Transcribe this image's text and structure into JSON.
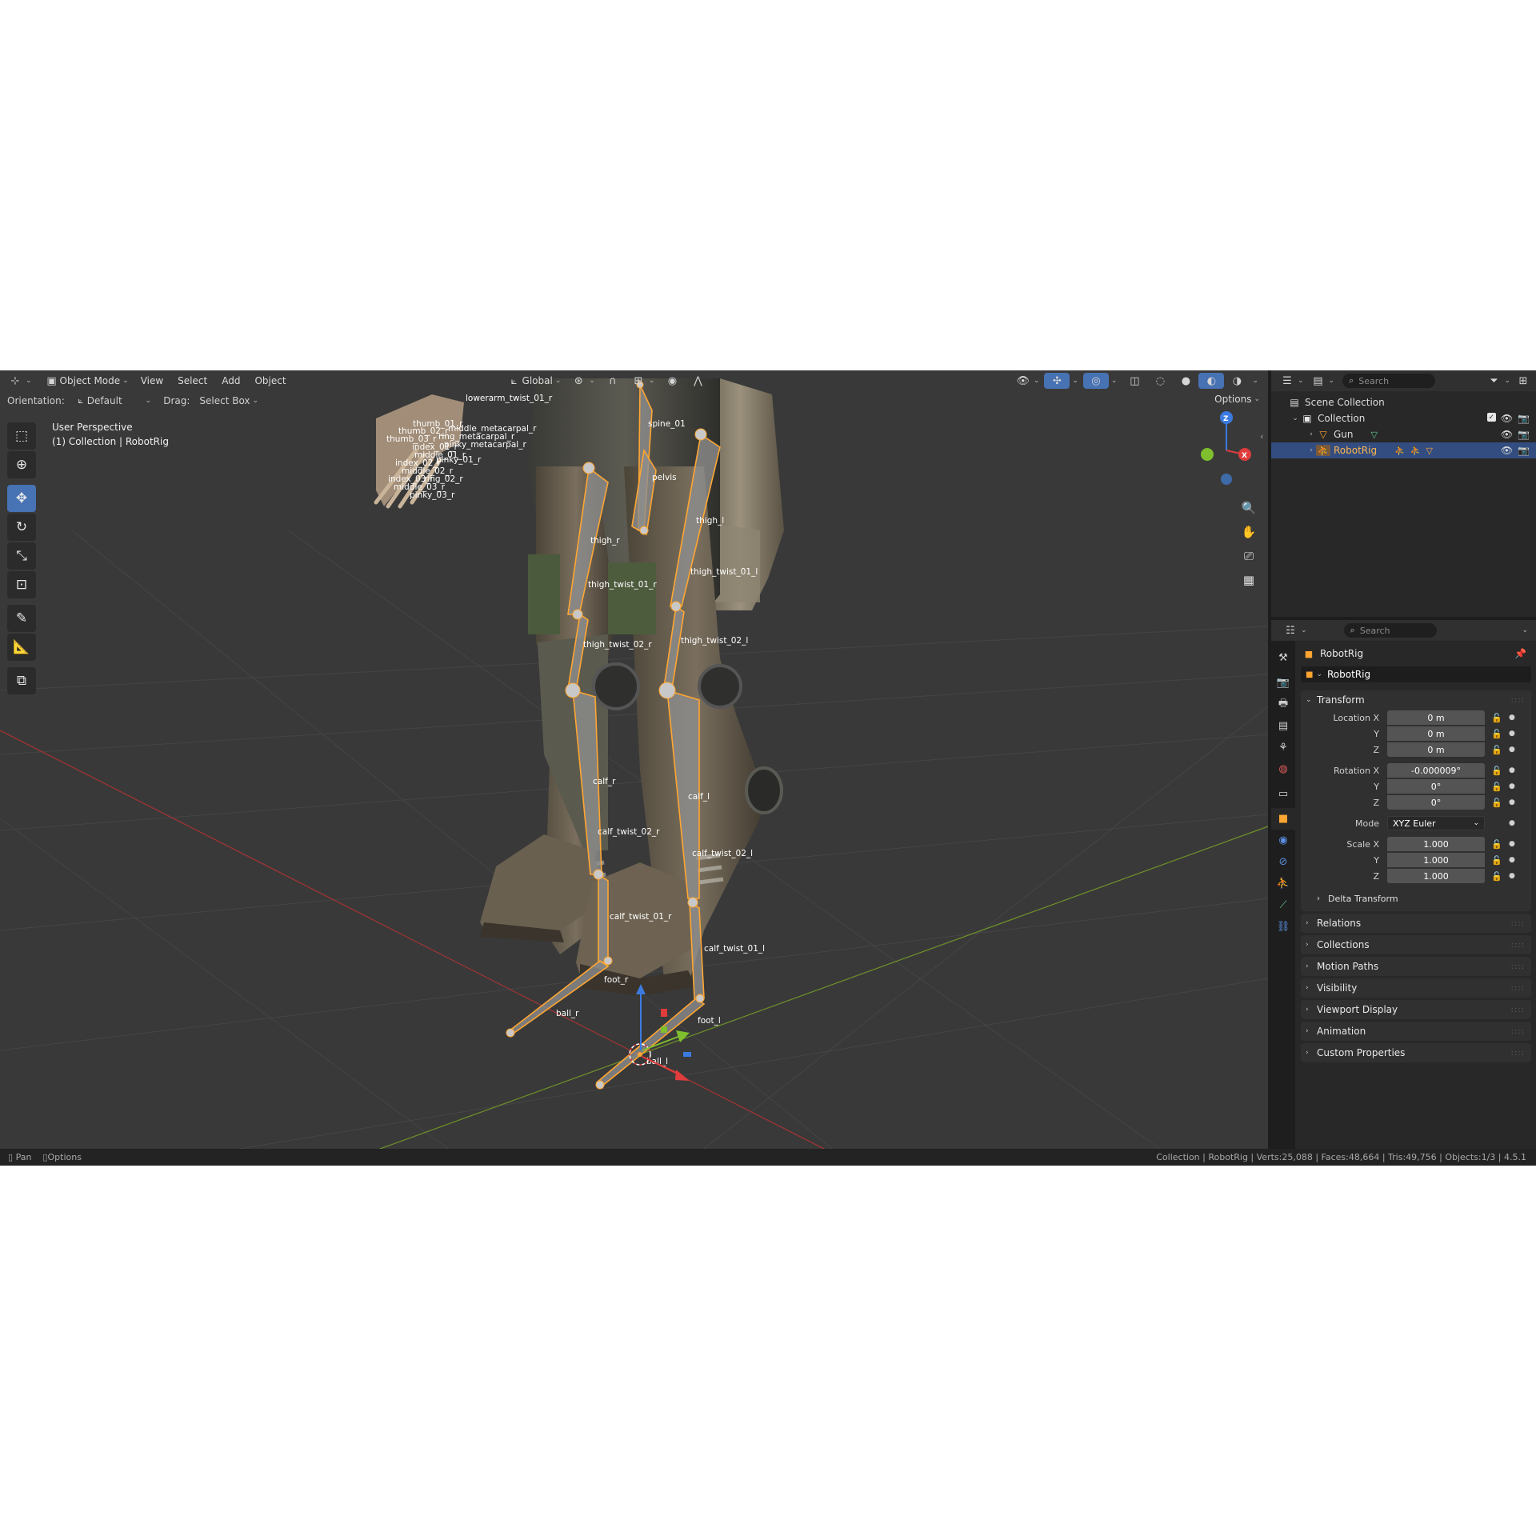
{
  "header": {
    "mode_label": "Object Mode",
    "menus": [
      "View",
      "Select",
      "Add",
      "Object"
    ],
    "orientation_global": "Global"
  },
  "subheader": {
    "orientation_label": "Orientation:",
    "orientation_value": "Default",
    "drag_label": "Drag:",
    "drag_value": "Select Box",
    "options_label": "Options"
  },
  "viewport": {
    "perspective": "User Perspective",
    "context": "(1) Collection | RobotRig",
    "gizmo_axes": [
      "Z",
      "X"
    ]
  },
  "bones": [
    "lowerarm_twist_01_r",
    "thumb_01_r",
    "middle_metacarpal_r",
    "thumb_02_r",
    "ring_metacarpal_r",
    "thumb_03_r",
    "pinky_metacarpal_r",
    "index_01_r",
    "middle_01_r",
    "index_02_r",
    "pinky_01_r",
    "middle_02_r",
    "index_03_r",
    "ring_02_r",
    "middle_03_r",
    "pinky_03_r",
    "spine_01",
    "pelvis",
    "thigh_r",
    "thigh_l",
    "thigh_twist_01_r",
    "thigh_twist_01_l",
    "thigh_twist_02_r",
    "thigh_twist_02_l",
    "calf_r",
    "calf_l",
    "calf_twist_02_r",
    "calf_twist_02_l",
    "calf_twist_01_r",
    "calf_twist_01_l",
    "foot_r",
    "foot_l",
    "ball_r",
    "ball_l"
  ],
  "outliner": {
    "search_placeholder": "Search",
    "scene_collection": "Scene Collection",
    "collection": "Collection",
    "items": [
      {
        "name": "Gun"
      },
      {
        "name": "RobotRig",
        "selected": true
      }
    ]
  },
  "properties": {
    "search_placeholder": "Search",
    "object_name": "RobotRig",
    "datablock_name": "RobotRig",
    "transform": {
      "title": "Transform",
      "location_label": "Location X",
      "location": [
        "0 m",
        "0 m",
        "0 m"
      ],
      "rotation_label": "Rotation X",
      "rotation": [
        "-0.000009°",
        "0°",
        "0°"
      ],
      "mode_label": "Mode",
      "mode_value": "XYZ Euler",
      "scale_label": "Scale X",
      "scale": [
        "1.000",
        "1.000",
        "1.000"
      ],
      "y_label": "Y",
      "z_label": "Z",
      "delta_transform": "Delta Transform"
    },
    "panels": [
      "Relations",
      "Collections",
      "Motion Paths",
      "Visibility",
      "Viewport Display",
      "Animation",
      "Custom Properties"
    ]
  },
  "status": {
    "left": [
      "Pan",
      "Options"
    ],
    "right": "Collection | RobotRig | Verts:25,088 | Faces:48,664 | Tris:49,756 | Objects:1/3 | 4.5.1"
  },
  "colors": {
    "accent": "#4772b3",
    "selection_orange": "#ffa632",
    "axis_x": "#e03c3c",
    "axis_y": "#7fbf2e",
    "axis_z": "#3b7be0"
  }
}
